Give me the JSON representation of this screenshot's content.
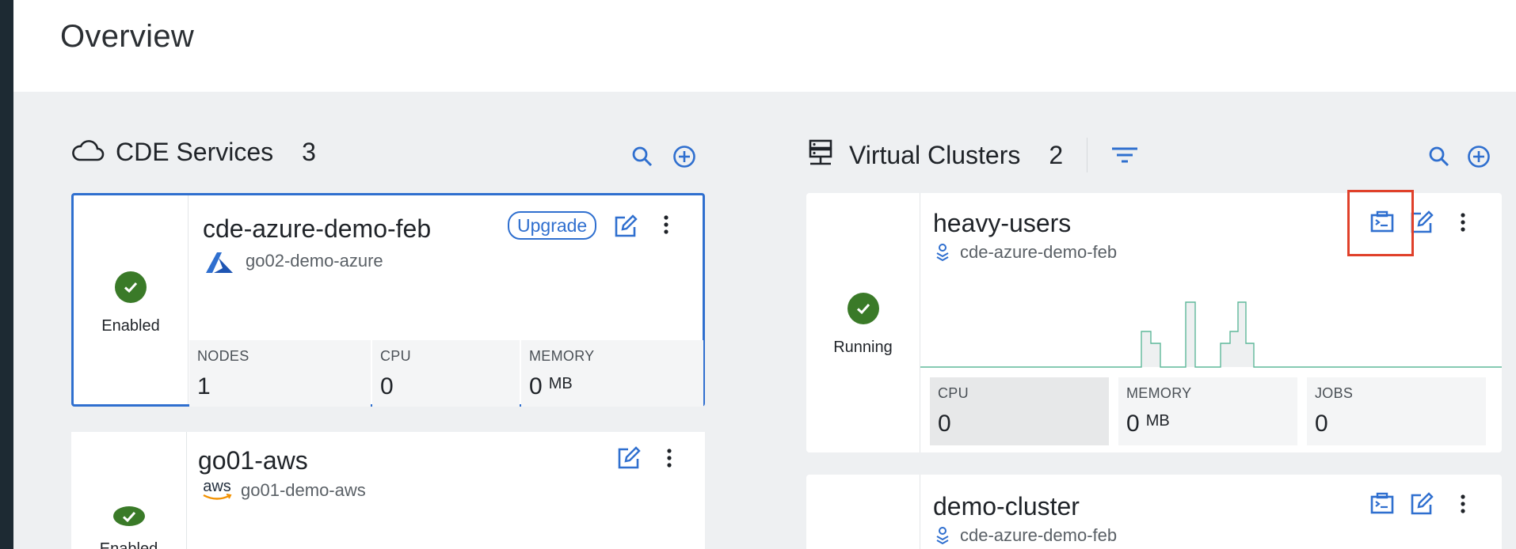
{
  "page": {
    "title": "Overview"
  },
  "services": {
    "title": "CDE Services",
    "count": "3",
    "cards": [
      {
        "name": "cde-azure-demo-feb",
        "status": "Enabled",
        "subtitle": "go02-demo-azure",
        "provider_icon": "azure-logo-icon",
        "upgrade_label": "Upgrade",
        "metrics": [
          {
            "label": "NODES",
            "value": "1",
            "unit": ""
          },
          {
            "label": "CPU",
            "value": "0",
            "unit": ""
          },
          {
            "label": "MEMORY",
            "value": "0",
            "unit": "MB"
          }
        ]
      },
      {
        "name": "go01-aws",
        "status": "Enabled",
        "subtitle": "go01-demo-aws",
        "provider_icon": "aws-logo-icon",
        "provider_text": "aws"
      }
    ]
  },
  "clusters": {
    "title": "Virtual Clusters",
    "count": "2",
    "cards": [
      {
        "name": "heavy-users",
        "status": "Running",
        "subtitle": "cde-azure-demo-feb",
        "metrics": [
          {
            "label": "CPU",
            "value": "0",
            "unit": ""
          },
          {
            "label": "MEMORY",
            "value": "0",
            "unit": "MB"
          },
          {
            "label": "JOBS",
            "value": "0",
            "unit": ""
          }
        ]
      },
      {
        "name": "demo-cluster",
        "subtitle": "cde-azure-demo-feb"
      }
    ]
  },
  "colors": {
    "accent": "#2f6fcf",
    "status_ok": "#3a7a28",
    "highlight": "#e0402a",
    "chart_line": "#5fb89a"
  }
}
